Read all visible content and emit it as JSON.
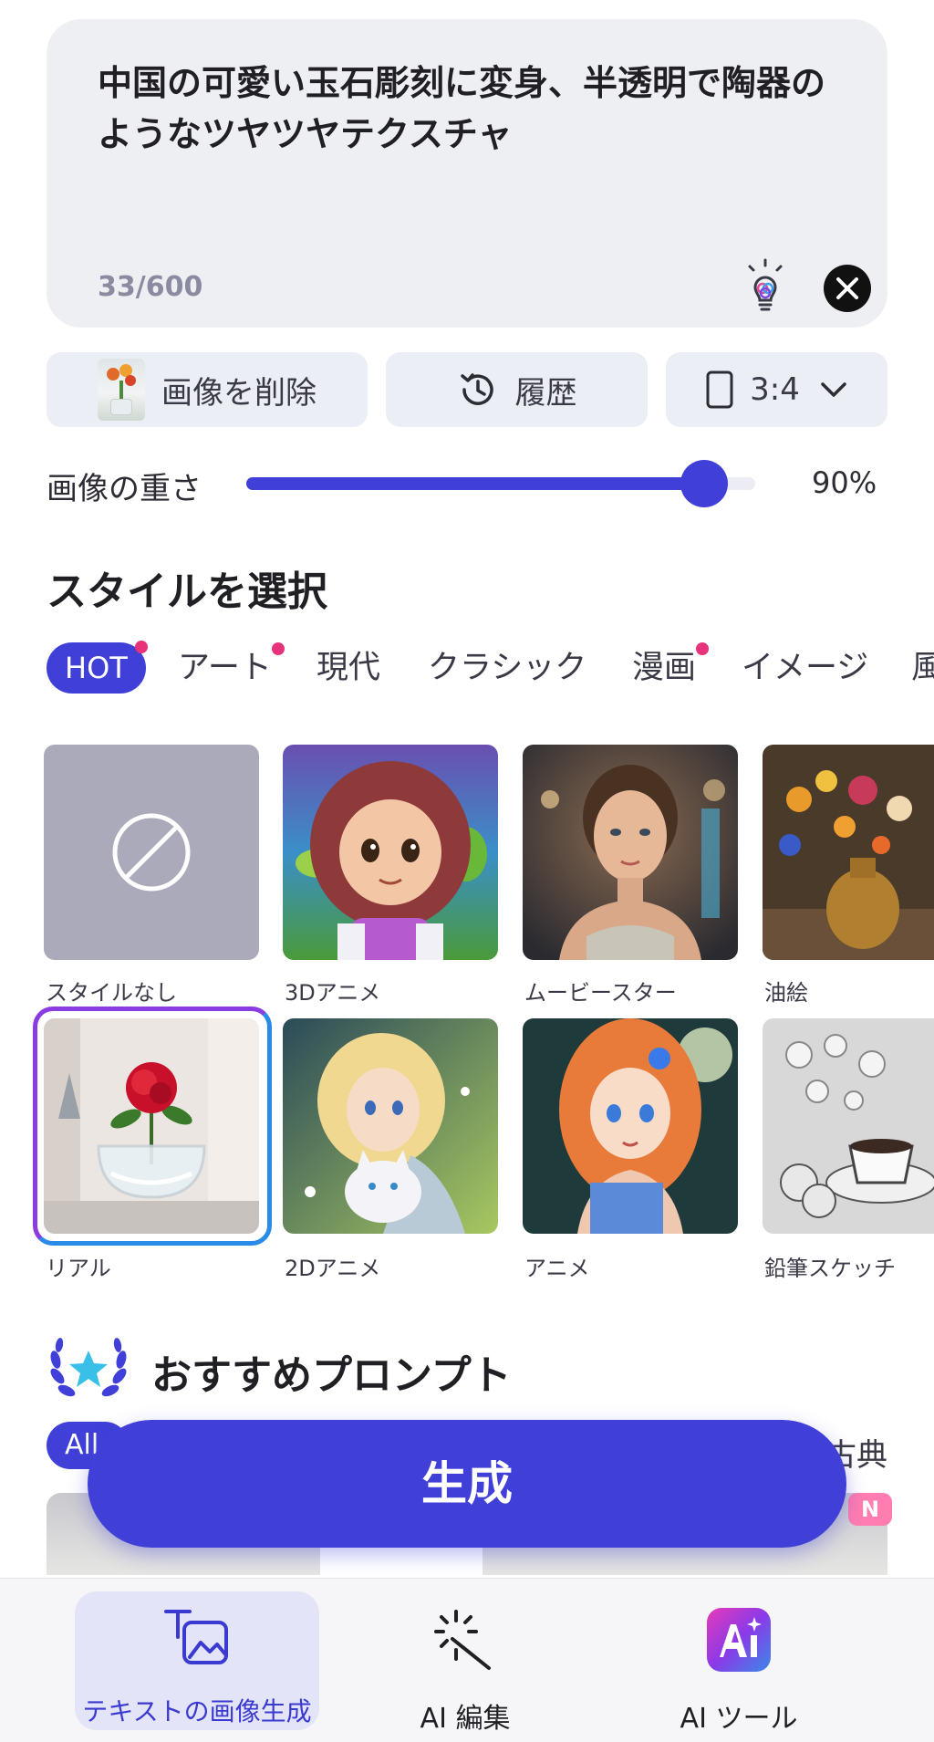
{
  "prompt": {
    "text": "中国の可愛い玉石彫刻に変身、半透明で陶器のようなツヤツヤテクスチャ",
    "char_count": "33/600"
  },
  "controls": {
    "delete_image_label": "画像を削除",
    "history_label": "履歴",
    "aspect_ratio": "3:4"
  },
  "image_weight": {
    "label": "画像の重さ",
    "value_text": "90%",
    "fraction": 0.9
  },
  "style_section": {
    "title": "スタイルを選択",
    "tabs": [
      {
        "label": "HOT",
        "active": true,
        "dot": true
      },
      {
        "label": "アート",
        "active": false,
        "dot": true
      },
      {
        "label": "現代",
        "active": false,
        "dot": false
      },
      {
        "label": "クラシック",
        "active": false,
        "dot": false
      },
      {
        "label": "漫画",
        "active": false,
        "dot": true
      },
      {
        "label": "イメージ",
        "active": false,
        "dot": false
      },
      {
        "label": "風",
        "active": false,
        "dot": false
      }
    ],
    "styles": [
      {
        "label": "スタイルなし"
      },
      {
        "label": "3Dアニメ"
      },
      {
        "label": "ムービースター"
      },
      {
        "label": "油絵"
      },
      {
        "label": "リアル",
        "selected": true
      },
      {
        "label": "2Dアニメ"
      },
      {
        "label": "アニメ"
      },
      {
        "label": "鉛筆スケッチ"
      }
    ]
  },
  "recommended": {
    "title": "おすすめプロンプト",
    "chip_all": "All",
    "chip_classic": "古典",
    "badge_new": "N"
  },
  "generate_label": "生成",
  "bottom_nav": {
    "items": [
      {
        "label": "テキストの画像生成",
        "active": true
      },
      {
        "label": "AI 編集",
        "active": false
      },
      {
        "label": "AI ツール",
        "active": false
      }
    ]
  },
  "colors": {
    "accent": "#4040d8",
    "hot_dot": "#e6337a"
  }
}
